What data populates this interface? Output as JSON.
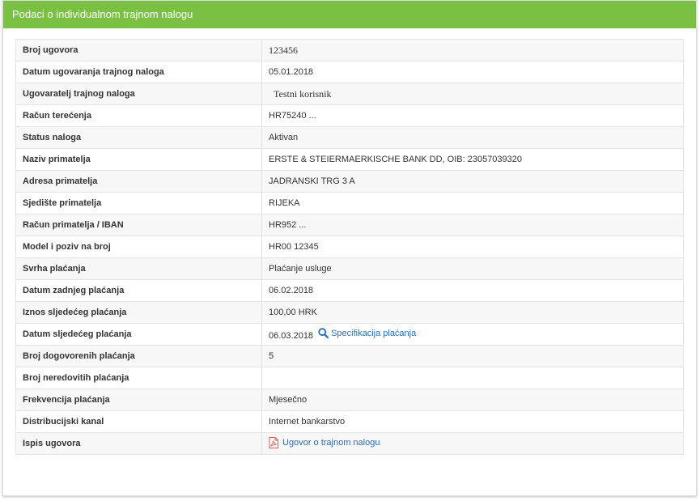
{
  "panel": {
    "title": "Podaci o individualnom trajnom nalogu",
    "header_color": "#7ac143",
    "link_color": "#2a6ebb",
    "pdf_icon_color": "#e2574c"
  },
  "rows": [
    {
      "label": "Broj ugovora",
      "value": "123456"
    },
    {
      "label": "Datum ugovaranja trajnog naloga",
      "value": "05.01.2018"
    },
    {
      "label": "Ugovaratelj trajnog naloga",
      "value": "Testni korisnik"
    },
    {
      "label": "Račun terećenja",
      "value": "HR75240 ..."
    },
    {
      "label": "Status naloga",
      "value": "Aktivan"
    },
    {
      "label": "Naziv primatelja",
      "value": "ERSTE & STEIERMAERKISCHE BANK DD, OIB: 23057039320"
    },
    {
      "label": "Adresa primatelja",
      "value": "JADRANSKI TRG 3 A"
    },
    {
      "label": "Sjedište primatelja",
      "value": "RIJEKA"
    },
    {
      "label": "Račun primatelja / IBAN",
      "value": "HR952 ..."
    },
    {
      "label": "Model i poziv na broj",
      "value": "HR00 12345"
    },
    {
      "label": "Svrha plaćanja",
      "value": "Plaćanje usluge"
    },
    {
      "label": "Datum zadnjeg plaćanja",
      "value": "06.02.2018"
    },
    {
      "label": "Iznos sljedećeg plaćanja",
      "value": "100,00 HRK"
    },
    {
      "label": "Datum sljedećeg plaćanja",
      "value": "06.03.2018",
      "link": "Specifikacija plaćanja",
      "link_icon": "search-icon"
    },
    {
      "label": "Broj dogovorenih plaćanja",
      "value": "5"
    },
    {
      "label": "Broj neredovitih plaćanja",
      "value": ""
    },
    {
      "label": "Frekvencija plaćanja",
      "value": "Mjesečno"
    },
    {
      "label": "Distribucijski kanal",
      "value": "Internet bankarstvo"
    },
    {
      "label": "Ispis ugovora",
      "value": "",
      "link": "Ugovor o trajnom nalogu",
      "link_icon": "pdf-icon"
    }
  ]
}
